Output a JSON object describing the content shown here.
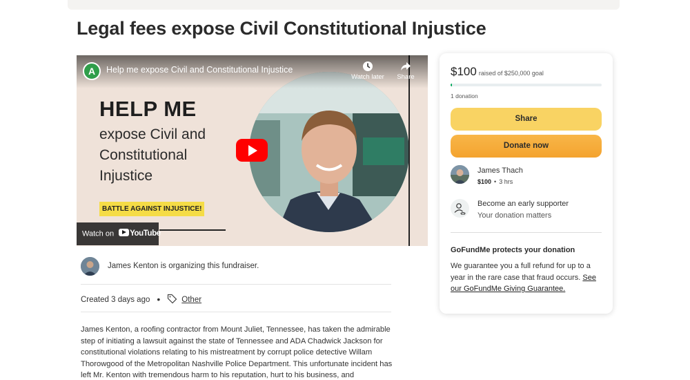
{
  "page": {
    "title": "Legal fees expose Civil Constitutional Injustice"
  },
  "video": {
    "channel_initial": "A",
    "title": "Help me expose Civil and Constitutional Injustice",
    "watch_later_label": "Watch later",
    "share_label": "Share",
    "thumbnail_headline": "HELP ME",
    "thumbnail_subtext": "expose Civil and\nConstitutional\nInjustice",
    "thumbnail_badge": "BATTLE AGAINST INJUSTICE!",
    "watch_on_label": "Watch on",
    "youtube_label": "YouTube",
    "play_button_color": "#ff0000"
  },
  "organizer": {
    "name": "James Kenton",
    "text_suffix": " is organizing this fundraiser."
  },
  "meta": {
    "created": "Created 3 days ago",
    "category": "Other"
  },
  "story": {
    "text": "James Kenton, a roofing contractor from Mount Juliet, Tennessee, has taken the admirable step of initiating a lawsuit against the state of Tennessee and ADA Chadwick Jackson for constitutional violations relating to his mistreatment by corrupt police detective Willam Thorowgood of the Metropolitan Nashville Police Department. This unfortunate incident has left Mr. Kenton with tremendous harm to his reputation, hurt to his business, and"
  },
  "donation_card": {
    "raised_amount": "$100",
    "goal_text": "raised of $250,000 goal",
    "progress_fraction": 0.0004,
    "donation_count": "1 donation",
    "share_label": "Share",
    "donate_label": "Donate now",
    "share_color": "#f9d363",
    "donate_color": "#f4a32f",
    "progress_color": "#02a95c",
    "recent_donor": {
      "name": "James Thach",
      "amount": "$100",
      "time": "3 hrs"
    },
    "early_supporter": {
      "title": "Become an early supporter",
      "subtitle": "Your donation matters"
    },
    "protection": {
      "title": "GoFundMe protects your donation",
      "text": "We guarantee you a full refund for up to a year in the rare case that fraud occurs. ",
      "link": "See our GoFundMe Giving Guarantee."
    }
  }
}
